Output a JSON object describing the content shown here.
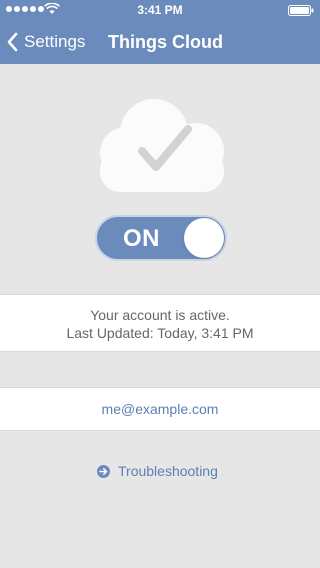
{
  "status_bar": {
    "time": "3:41 PM"
  },
  "nav": {
    "back_label": "Settings",
    "title": "Things Cloud"
  },
  "sync": {
    "state": "ON",
    "enabled": true
  },
  "account": {
    "status_line": "Your account is active.",
    "updated_line": "Last Updated: Today, 3:41 PM",
    "email": "me@example.com"
  },
  "help": {
    "troubleshooting_label": "Troubleshooting"
  },
  "icons": {
    "back": "chevron-left-icon",
    "cloud": "cloud-check-icon",
    "troubleshoot": "arrow-right-circle-icon"
  },
  "colors": {
    "accent": "#6b8bbd",
    "link": "#5c7fb4",
    "background": "#e6e6e6"
  }
}
